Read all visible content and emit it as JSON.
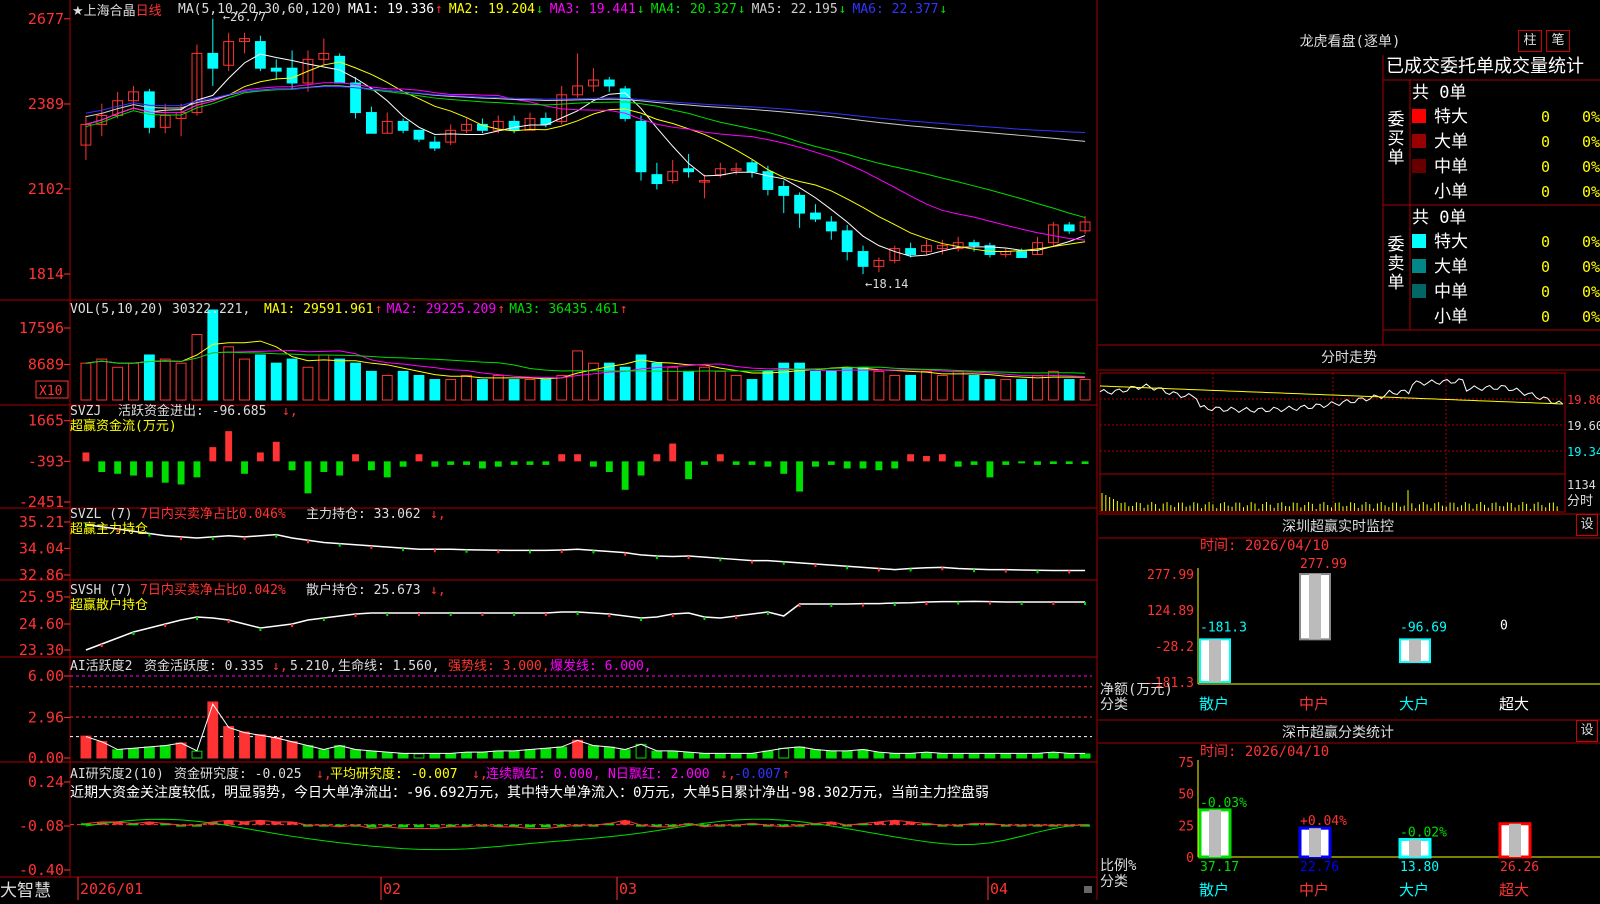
{
  "colors": {
    "up": "#ff3333",
    "down": "#00ffff",
    "ma1": "#ffffff",
    "ma2": "#ffff00",
    "ma3": "#ff00ff",
    "ma4": "#00dd00",
    "ma5": "#cccccc",
    "ma6": "#3333ff",
    "grid": "#aa0000",
    "green": "#00dd00",
    "magenta": "#ff00ff"
  },
  "main": {
    "title_star": "★",
    "stock_name": "上海合晶",
    "period": "日线",
    "ma_label": "MA(5,10,20,30,60,120)",
    "ma_values": [
      {
        "label": "MA1: 19.336",
        "arrow": "↑",
        "color": "#ffffff"
      },
      {
        "label": "MA2: 19.204",
        "arrow": "↓",
        "color": "#ffff00"
      },
      {
        "label": "MA3: 19.441",
        "arrow": "↓",
        "color": "#ff00ff"
      },
      {
        "label": "MA4: 20.327",
        "arrow": "↓",
        "color": "#00dd00"
      },
      {
        "label": "MA5: 22.195",
        "arrow": "↓",
        "color": "#cccccc"
      },
      {
        "label": "MA6: 22.377",
        "arrow": "↓",
        "color": "#3333ff"
      }
    ],
    "y_ticks": [
      "2677",
      "2389",
      "2102",
      "1814"
    ],
    "high_label": "26.77",
    "low_label": "18.14"
  },
  "volume": {
    "label": "VOL(5,10,20)",
    "value": "30322.221",
    "ma": [
      {
        "label": "MA1: 29591.961",
        "arrow": "↑",
        "color": "#ffff00"
      },
      {
        "label": "MA2: 29225.209",
        "arrow": "↑",
        "color": "#ff00ff"
      },
      {
        "label": "MA3: 36435.461",
        "arrow": "↑",
        "color": "#00dd00"
      }
    ],
    "y_ticks": [
      "17596",
      "8689"
    ],
    "unit": "X10"
  },
  "svzj": {
    "label": "SVZJ",
    "text": "活跃资金进出: -96.685",
    "arrow": "↓,",
    "subtitle": "超赢资金流(万元)",
    "y_ticks": [
      "1665",
      "-393",
      "-2451"
    ]
  },
  "svzl": {
    "label": "SVZL (7)",
    "text1": "7日内买卖净占比0.046%",
    "text2": "主力持仓: 33.062",
    "arrow": "↓,",
    "subtitle": "超赢主力持仓",
    "y_ticks": [
      "35.21",
      "34.04",
      "32.86"
    ]
  },
  "svsh": {
    "label": "SVSH (7)",
    "text1": "7日内买卖净占比0.042%",
    "text2": "散户持仓: 25.673",
    "arrow": "↓,",
    "subtitle": "超赢散户持仓",
    "y_ticks": [
      "25.95",
      "24.60",
      "23.30"
    ]
  },
  "ai1": {
    "label": "AI活跃度2",
    "text": "资金活跃度: 0.335",
    "arrow": "↓,",
    "v2": "5.210,",
    "life": "生命线: 1.560,",
    "strong": "强势线: 3.000,",
    "burst": "爆发线: 6.000,",
    "y_ticks": [
      "6.00",
      "2.96",
      "0.00"
    ]
  },
  "ai2": {
    "label": "AI研究度2(10)",
    "text": "资金研究度: -0.025",
    "arrow": "↓,",
    "avg": "平均研究度: -0.007",
    "avg_arrow": "↓,",
    "red": "连续飘红: 0.000,",
    "nred": "N日飘红: 2.000",
    "nred_arrow": "↓,",
    "last": "-0.007",
    "last_arrow": "↑",
    "desc": "近期大资金关注度较低，明显弱势，今日大单净流出：-96.692万元，其中特大单净流入：0万元，大单5日累计净出-98.302万元，当前主力控盘弱",
    "y_ticks": [
      "0.24",
      "-0.08",
      "-0.40"
    ]
  },
  "bottom": {
    "brand": "大智慧",
    "dates": [
      "2026/01",
      "02",
      "03",
      "04"
    ]
  },
  "dragon": {
    "title": "龙虎看盘(逐单)",
    "btn1": "柱",
    "btn2": "笔",
    "header": "已成交委托单成交量统计",
    "buy_label": "委买单",
    "sell_label": "委卖单",
    "buy_total": "共 0单",
    "sell_total": "共 0单",
    "buy_rows": [
      {
        "name": "特大",
        "color": "#ff0000",
        "val": "0",
        "pct": "0%"
      },
      {
        "name": "大单",
        "color": "#990000",
        "val": "0",
        "pct": "0%"
      },
      {
        "name": "中单",
        "color": "#660000",
        "val": "0",
        "pct": "0%"
      },
      {
        "name": "小单",
        "color": "",
        "val": "0",
        "pct": "0%"
      }
    ],
    "sell_rows": [
      {
        "name": "特大",
        "color": "#00ffff",
        "val": "0",
        "pct": "0%"
      },
      {
        "name": "大单",
        "color": "#008888",
        "val": "0",
        "pct": "0%"
      },
      {
        "name": "中单",
        "color": "#006666",
        "val": "0",
        "pct": "0%"
      },
      {
        "name": "小单",
        "color": "",
        "val": "0",
        "pct": "0%"
      }
    ]
  },
  "intraday": {
    "title": "分时走势",
    "p1": "19.86",
    "p2": "19.60",
    "p3": "19.34",
    "vol": "1134",
    "unit": "分时"
  },
  "monitor": {
    "title": "深圳超赢实时监控",
    "btn": "设",
    "time": "时间: 2026/04/10",
    "y_ticks": [
      "277.99",
      "124.89",
      "-28.2",
      "-181.3"
    ],
    "ylabel1": "净额(万元)",
    "ylabel2": "分类",
    "chart_data": {
      "type": "bar",
      "categories": [
        "散户",
        "中户",
        "大户",
        "超大"
      ],
      "values": [
        -181.3,
        277.99,
        -96.69,
        0
      ],
      "labels": [
        "-181.3",
        "277.99",
        "-96.69",
        "0"
      ],
      "ylim": [
        -181.3,
        277.99
      ]
    }
  },
  "classify": {
    "title": "深市超赢分类统计",
    "btn": "设",
    "time": "时间: 2026/04/10",
    "y_ticks": [
      "75",
      "50",
      "25",
      "0"
    ],
    "ylabel1": "比例%",
    "ylabel2": "分类",
    "chart_data": {
      "type": "bar",
      "categories": [
        "散户",
        "中户",
        "大户",
        "超大"
      ],
      "values": [
        37.17,
        22.76,
        13.8,
        26.26
      ],
      "changes": [
        "-0.03%",
        "+0.04%",
        "-0.02%",
        ""
      ],
      "ylim": [
        0,
        75
      ]
    }
  },
  "ohlc": [
    [
      22.5,
      23.5,
      22.0,
      23.2
    ],
    [
      23.2,
      23.9,
      22.8,
      23.5
    ],
    [
      23.5,
      24.3,
      23.4,
      24.0
    ],
    [
      24.0,
      24.5,
      23.7,
      24.3
    ],
    [
      24.3,
      24.4,
      22.9,
      23.1
    ],
    [
      23.1,
      23.9,
      22.9,
      23.5
    ],
    [
      23.4,
      23.9,
      22.8,
      23.6
    ],
    [
      23.6,
      25.9,
      23.5,
      25.6
    ],
    [
      25.6,
      26.77,
      24.5,
      25.1
    ],
    [
      25.2,
      26.3,
      25.0,
      26.0
    ],
    [
      26.0,
      26.3,
      25.6,
      26.1
    ],
    [
      26.0,
      26.2,
      25.0,
      25.1
    ],
    [
      25.1,
      25.4,
      24.7,
      25.0
    ],
    [
      25.1,
      25.7,
      24.4,
      24.6
    ],
    [
      24.6,
      25.7,
      24.3,
      25.4
    ],
    [
      25.4,
      26.1,
      25.2,
      25.6
    ],
    [
      25.5,
      25.6,
      24.6,
      24.6
    ],
    [
      24.6,
      24.8,
      23.4,
      23.6
    ],
    [
      23.6,
      23.8,
      22.9,
      22.9
    ],
    [
      22.9,
      23.6,
      22.9,
      23.3
    ],
    [
      23.3,
      23.4,
      22.9,
      23.0
    ],
    [
      23.0,
      23.0,
      22.6,
      22.7
    ],
    [
      22.6,
      22.8,
      22.3,
      22.4
    ],
    [
      22.6,
      23.2,
      22.5,
      23.0
    ],
    [
      23.0,
      23.4,
      22.9,
      23.2
    ],
    [
      23.2,
      23.4,
      22.9,
      23.0
    ],
    [
      23.0,
      23.5,
      22.9,
      23.3
    ],
    [
      23.3,
      23.5,
      22.9,
      23.0
    ],
    [
      23.0,
      23.6,
      23.0,
      23.4
    ],
    [
      23.4,
      23.6,
      23.1,
      23.2
    ],
    [
      23.3,
      24.5,
      23.2,
      24.2
    ],
    [
      24.2,
      25.6,
      24.1,
      24.5
    ],
    [
      24.5,
      25.1,
      24.3,
      24.7
    ],
    [
      24.7,
      24.8,
      24.3,
      24.5
    ],
    [
      24.4,
      24.5,
      23.3,
      23.4
    ],
    [
      23.3,
      23.5,
      21.3,
      21.6
    ],
    [
      21.5,
      21.9,
      21.0,
      21.2
    ],
    [
      21.3,
      22.0,
      21.2,
      21.6
    ],
    [
      21.7,
      22.2,
      21.4,
      21.6
    ],
    [
      21.3,
      21.5,
      20.7,
      21.3
    ],
    [
      21.5,
      21.9,
      21.4,
      21.7
    ],
    [
      21.7,
      21.9,
      21.5,
      21.7
    ],
    [
      21.9,
      22.0,
      21.4,
      21.6
    ],
    [
      21.6,
      21.8,
      20.8,
      21.0
    ],
    [
      21.1,
      21.3,
      20.2,
      20.8
    ],
    [
      20.8,
      20.9,
      19.7,
      20.2
    ],
    [
      20.2,
      20.5,
      19.9,
      20.0
    ],
    [
      19.9,
      20.1,
      19.3,
      19.6
    ],
    [
      19.6,
      19.8,
      18.6,
      18.9
    ],
    [
      18.9,
      19.1,
      18.14,
      18.4
    ],
    [
      18.4,
      18.7,
      18.2,
      18.6
    ],
    [
      18.6,
      19.1,
      18.5,
      19.0
    ],
    [
      19.0,
      19.2,
      18.7,
      18.8
    ],
    [
      18.9,
      19.3,
      18.8,
      19.1
    ],
    [
      19.0,
      19.3,
      18.8,
      19.1
    ],
    [
      19.0,
      19.4,
      18.9,
      19.2
    ],
    [
      19.2,
      19.3,
      18.9,
      19.1
    ],
    [
      19.1,
      19.2,
      18.7,
      18.8
    ],
    [
      18.8,
      19.0,
      18.7,
      18.9
    ],
    [
      18.9,
      19.0,
      18.7,
      18.7
    ],
    [
      18.8,
      19.4,
      18.8,
      19.2
    ],
    [
      19.2,
      19.9,
      19.1,
      19.8
    ],
    [
      19.8,
      19.9,
      19.5,
      19.6
    ],
    [
      19.6,
      20.1,
      19.5,
      19.9
    ]
  ],
  "vol_data": [
    9,
    10,
    8,
    9,
    11,
    10,
    9,
    16,
    22,
    13,
    10,
    11,
    9,
    10,
    8,
    11,
    10,
    9,
    7,
    6,
    7,
    6,
    5,
    5,
    6,
    5,
    6,
    5,
    5,
    5,
    6,
    12,
    9,
    9,
    8,
    11,
    9,
    8,
    7,
    8,
    7,
    6,
    5,
    7,
    9,
    9,
    7,
    7,
    8,
    8,
    7,
    6,
    6,
    7,
    6,
    7,
    6,
    5,
    5,
    5,
    6,
    7,
    5,
    5
  ],
  "zj_data": [
    500,
    -600,
    -700,
    -800,
    -900,
    -1200,
    -1300,
    -900,
    800,
    1700,
    -700,
    500,
    1100,
    -500,
    -1800,
    -600,
    -800,
    400,
    -500,
    -900,
    -300,
    400,
    -300,
    -200,
    -200,
    -400,
    -300,
    -200,
    -200,
    -200,
    400,
    400,
    -300,
    -600,
    -1600,
    -800,
    400,
    1000,
    -1000,
    -200,
    400,
    -200,
    -200,
    -300,
    -700,
    -1700,
    -300,
    -200,
    -400,
    -400,
    -500,
    -400,
    400,
    300,
    400,
    -300,
    -200,
    -900,
    -200,
    -100,
    -200,
    -150,
    -150,
    -150
  ],
  "zl_data": [
    35.1,
    35.0,
    34.9,
    34.8,
    34.7,
    34.6,
    34.55,
    34.5,
    34.55,
    34.6,
    34.55,
    34.6,
    34.65,
    34.5,
    34.4,
    34.3,
    34.25,
    34.2,
    34.15,
    34.1,
    34.05,
    34.0,
    34.0,
    34.0,
    33.98,
    33.97,
    33.96,
    33.95,
    33.95,
    33.95,
    33.97,
    34.0,
    33.95,
    33.9,
    33.85,
    33.75,
    33.7,
    33.68,
    33.7,
    33.65,
    33.6,
    33.55,
    33.5,
    33.5,
    33.45,
    33.4,
    33.35,
    33.3,
    33.25,
    33.2,
    33.15,
    33.1,
    33.15,
    33.18,
    33.2,
    33.15,
    33.12,
    33.1,
    33.1,
    33.08,
    33.07,
    33.06,
    33.06,
    33.06
  ],
  "sh_data": [
    23.3,
    23.6,
    23.9,
    24.2,
    24.4,
    24.6,
    24.8,
    24.95,
    24.9,
    24.8,
    24.6,
    24.4,
    24.5,
    24.6,
    24.8,
    24.9,
    25.0,
    25.1,
    25.15,
    25.15,
    25.15,
    25.15,
    25.15,
    25.15,
    25.15,
    25.15,
    25.15,
    25.15,
    25.15,
    25.15,
    25.2,
    25.2,
    25.15,
    25.1,
    25.0,
    24.9,
    24.95,
    25.1,
    25.15,
    24.95,
    24.9,
    25.0,
    25.1,
    25.2,
    25.0,
    25.6,
    25.6,
    25.6,
    25.6,
    25.62,
    25.62,
    25.65,
    25.66,
    25.7,
    25.72,
    25.72,
    25.73,
    25.72,
    25.7,
    25.7,
    25.7,
    25.7,
    25.7,
    25.7
  ],
  "ai1_data": [
    1.6,
    1.2,
    0.6,
    0.7,
    0.8,
    0.9,
    1.1,
    0.5,
    4.1,
    2.3,
    1.9,
    1.7,
    1.5,
    1.2,
    0.9,
    0.6,
    0.9,
    0.6,
    0.5,
    0.4,
    0.3,
    0.3,
    0.3,
    0.3,
    0.4,
    0.4,
    0.5,
    0.5,
    0.6,
    0.7,
    0.8,
    1.3,
    0.9,
    0.8,
    0.6,
    1.0,
    0.5,
    0.5,
    0.4,
    0.3,
    0.3,
    0.3,
    0.3,
    0.5,
    0.7,
    0.8,
    0.6,
    0.5,
    0.5,
    0.6,
    0.4,
    0.3,
    0.3,
    0.4,
    0.3,
    0.3,
    0.3,
    0.3,
    0.3,
    0.3,
    0.3,
    0.4,
    0.3,
    0.3
  ],
  "ai2_data": [
    -0.06,
    -0.05,
    -0.05,
    -0.06,
    -0.05,
    -0.06,
    -0.07,
    -0.07,
    -0.05,
    -0.04,
    -0.05,
    -0.04,
    -0.05,
    -0.05,
    -0.07,
    -0.07,
    -0.08,
    -0.07,
    -0.09,
    -0.08,
    -0.09,
    -0.09,
    -0.09,
    -0.08,
    -0.08,
    -0.07,
    -0.08,
    -0.08,
    -0.09,
    -0.09,
    -0.08,
    -0.07,
    -0.07,
    -0.06,
    -0.04,
    -0.07,
    -0.08,
    -0.08,
    -0.06,
    -0.08,
    -0.07,
    -0.07,
    -0.06,
    -0.07,
    -0.08,
    -0.07,
    -0.06,
    -0.05,
    -0.07,
    -0.06,
    -0.05,
    -0.04,
    -0.05,
    -0.06,
    -0.07,
    -0.07,
    -0.06,
    -0.06,
    -0.07,
    -0.07,
    -0.07,
    -0.07,
    -0.07,
    -0.07
  ]
}
